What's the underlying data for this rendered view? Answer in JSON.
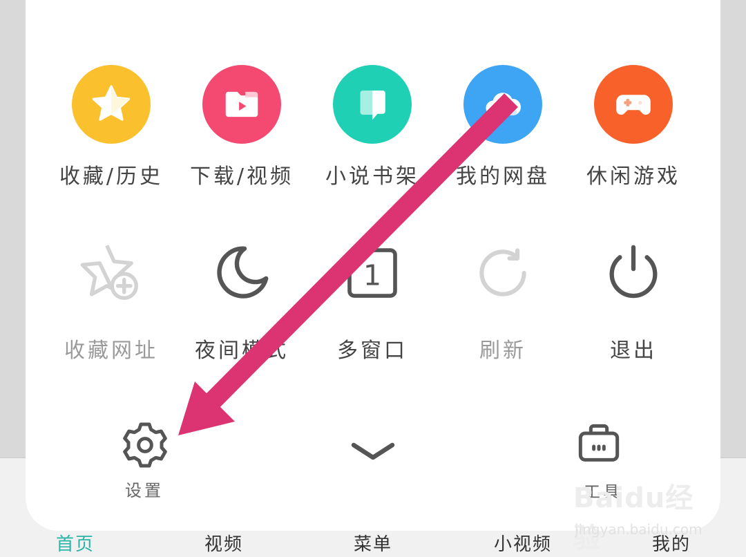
{
  "bottom_nav": {
    "home": "首页",
    "video": "视频",
    "menu": "菜单",
    "short_video": "小视频",
    "mine": "我的"
  },
  "row1": [
    {
      "label": "收藏/历史",
      "icon": "star-icon",
      "color": "#fbc02d"
    },
    {
      "label": "下载/视频",
      "icon": "video-folder-icon",
      "color": "#f44a72"
    },
    {
      "label": "小说书架",
      "icon": "book-icon",
      "color": "#1fd0b4"
    },
    {
      "label": "我的网盘",
      "icon": "cloud-icon",
      "color": "#3da5f4"
    },
    {
      "label": "休闲游戏",
      "icon": "gamepad-icon",
      "color": "#f8612a"
    }
  ],
  "row2": [
    {
      "label": "收藏网址",
      "icon": "add-bookmark-icon",
      "enabled": false
    },
    {
      "label": "夜间模式",
      "icon": "moon-icon",
      "enabled": true
    },
    {
      "label": "多窗口",
      "icon": "window-count-icon",
      "enabled": true,
      "count": "1"
    },
    {
      "label": "刷新",
      "icon": "refresh-icon",
      "enabled": false
    },
    {
      "label": "退出",
      "icon": "power-icon",
      "enabled": true
    }
  ],
  "footer": {
    "settings": "设置",
    "tools": "工具",
    "collapse_icon": "chevron-down-icon"
  },
  "annotation": {
    "color": "#dc3373",
    "icon": "arrow-pointer-icon"
  },
  "watermark": {
    "logo": "Baidu经验",
    "url": "jingyan.baidu.com"
  }
}
